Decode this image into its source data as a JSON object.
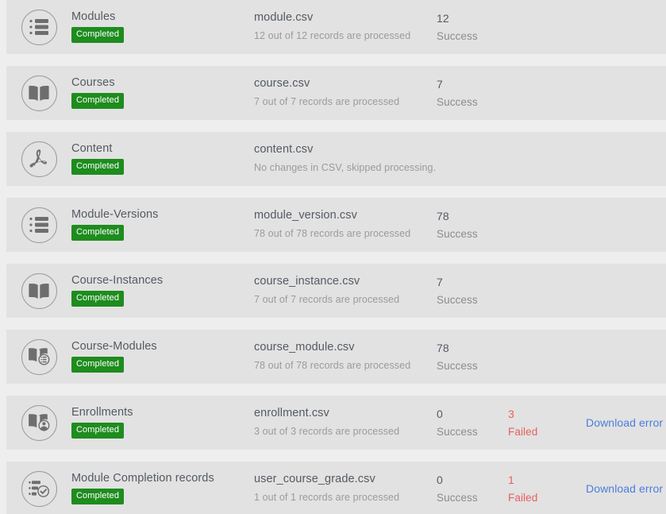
{
  "theme": {
    "page_background": "#eeeeee",
    "row_background": "#e2e2e2",
    "badge_color": "#1e8c1e",
    "failed_color": "#e8605d",
    "link_color": "#4a7ede",
    "text_color": "#545a62",
    "muted_text_color": "#9b9b9b"
  },
  "labels": {
    "success": "Success",
    "failed": "Failed",
    "download_error_records": "Download error records"
  },
  "rows": [
    {
      "icon": "list-icon",
      "name": "Modules",
      "status": "Completed",
      "file": "module.csv",
      "note": "12 out of 12 records are processed",
      "success_count": "12",
      "success_label": "Success",
      "failed_count": "",
      "failed_label": "",
      "action": ""
    },
    {
      "icon": "book-icon",
      "name": "Courses",
      "status": "Completed",
      "file": "course.csv",
      "note": "7 out of 7 records are processed",
      "success_count": "7",
      "success_label": "Success",
      "failed_count": "",
      "failed_label": "",
      "action": ""
    },
    {
      "icon": "pdf-icon",
      "name": "Content",
      "status": "Completed",
      "file": "content.csv",
      "note": "No changes in CSV, skipped processing.",
      "success_count": "",
      "success_label": "",
      "failed_count": "",
      "failed_label": "",
      "action": ""
    },
    {
      "icon": "list-icon",
      "name": "Module-Versions",
      "status": "Completed",
      "file": "module_version.csv",
      "note": "78 out of 78 records are processed",
      "success_count": "78",
      "success_label": "Success",
      "failed_count": "",
      "failed_label": "",
      "action": ""
    },
    {
      "icon": "book-icon",
      "name": "Course-Instances",
      "status": "Completed",
      "file": "course_instance.csv",
      "note": "7 out of 7 records are processed",
      "success_count": "7",
      "success_label": "Success",
      "failed_count": "",
      "failed_label": "",
      "action": ""
    },
    {
      "icon": "book-list-icon",
      "name": "Course-Modules",
      "status": "Completed",
      "file": "course_module.csv",
      "note": "78 out of 78 records are processed",
      "success_count": "78",
      "success_label": "Success",
      "failed_count": "",
      "failed_label": "",
      "action": ""
    },
    {
      "icon": "book-user-icon",
      "name": "Enrollments",
      "status": "Completed",
      "file": "enrollment.csv",
      "note": "3 out of 3 records are processed",
      "success_count": "0",
      "success_label": "Success",
      "failed_count": "3",
      "failed_label": "Failed",
      "action": "Download error records"
    },
    {
      "icon": "checklist-icon",
      "name": "Module Completion records",
      "status": "Completed",
      "file": "user_course_grade.csv",
      "note": "1 out of 1 records are processed",
      "success_count": "0",
      "success_label": "Success",
      "failed_count": "1",
      "failed_label": "Failed",
      "action": "Download error records"
    }
  ]
}
